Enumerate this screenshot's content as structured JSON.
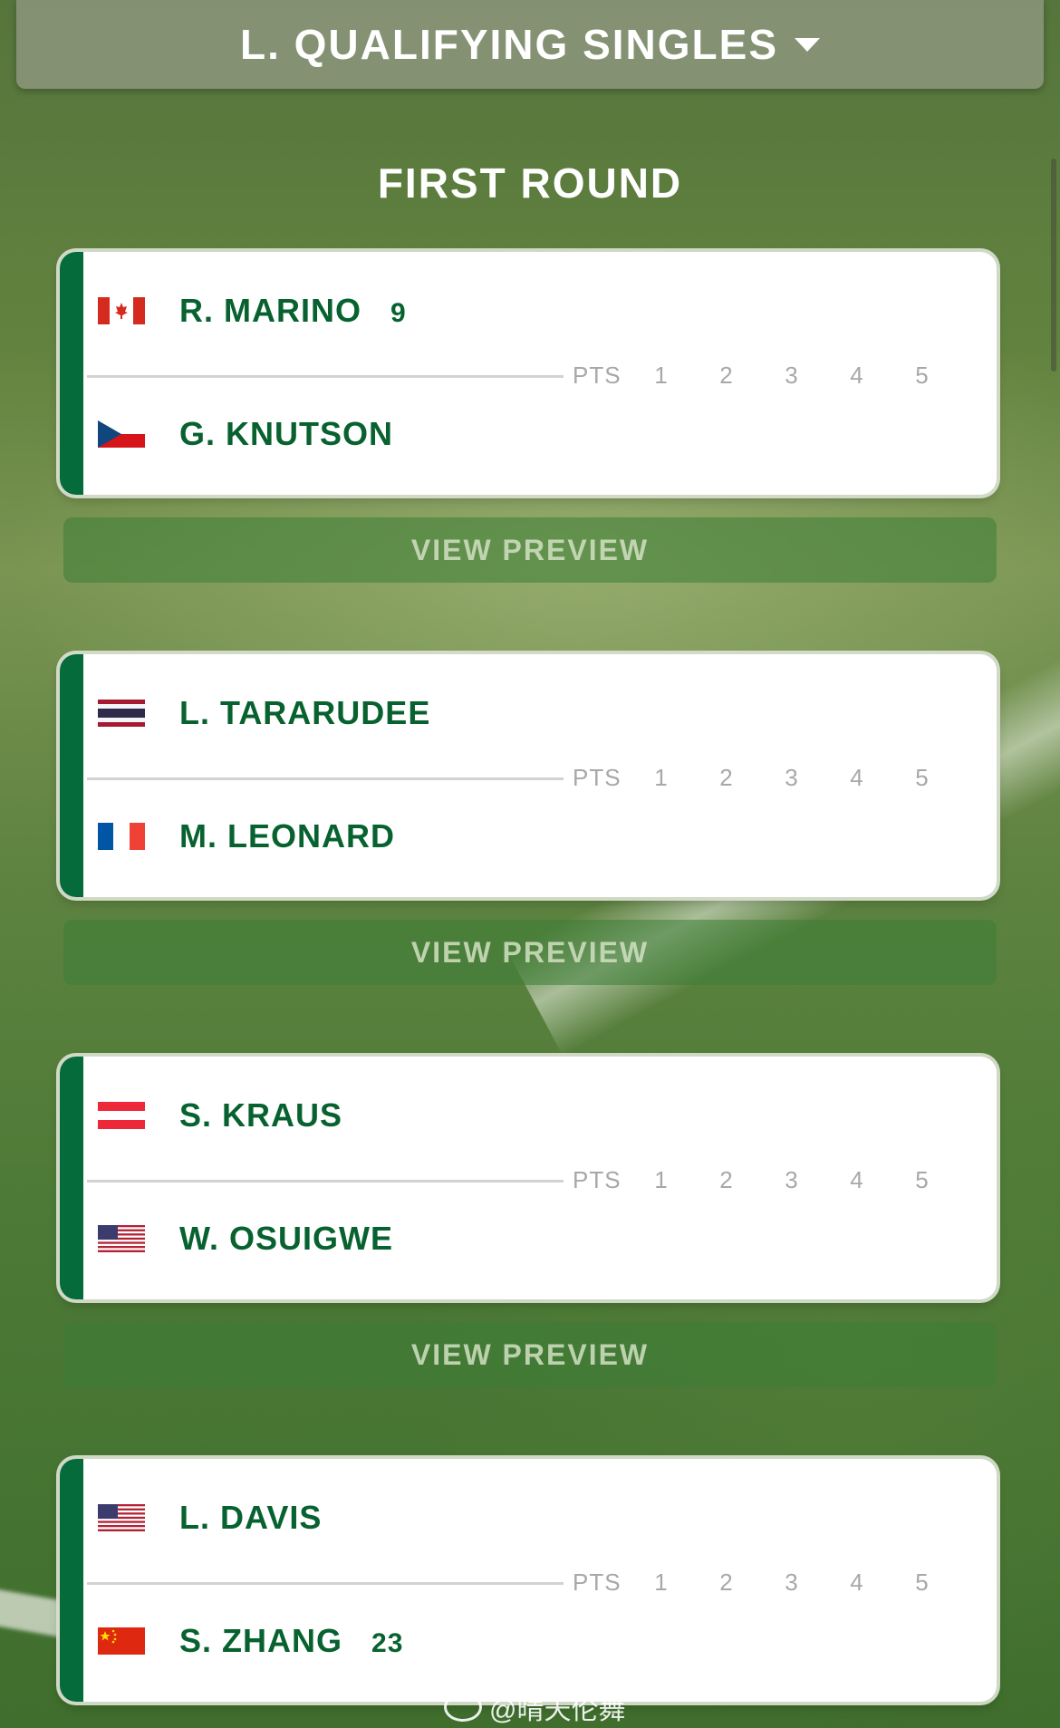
{
  "header": {
    "title": "L. QUALIFYING SINGLES"
  },
  "round_title": "FIRST ROUND",
  "score_columns": {
    "pts": "PTS",
    "sets": [
      "1",
      "2",
      "3",
      "4",
      "5"
    ]
  },
  "preview_label": "VIEW PREVIEW",
  "matches": [
    {
      "p1": {
        "name": "R. MARINO",
        "seed": "9",
        "flag": "canada-flag"
      },
      "p2": {
        "name": "G. KNUTSON",
        "seed": "",
        "flag": "czech-republic-flag"
      }
    },
    {
      "p1": {
        "name": "L. TARARUDEE",
        "seed": "",
        "flag": "thailand-flag"
      },
      "p2": {
        "name": "M. LEONARD",
        "seed": "",
        "flag": "france-flag"
      }
    },
    {
      "p1": {
        "name": "S. KRAUS",
        "seed": "",
        "flag": "austria-flag"
      },
      "p2": {
        "name": "W. OSUIGWE",
        "seed": "",
        "flag": "usa-flag"
      }
    },
    {
      "p1": {
        "name": "L. DAVIS",
        "seed": "",
        "flag": "usa-flag"
      },
      "p2": {
        "name": "S. ZHANG",
        "seed": "23",
        "flag": "china-flag"
      }
    }
  ],
  "colors": {
    "accent": "#056b3a",
    "name_text": "#07622f",
    "score_head": "#a8a8a8"
  },
  "watermark": "@晴天伦舞"
}
